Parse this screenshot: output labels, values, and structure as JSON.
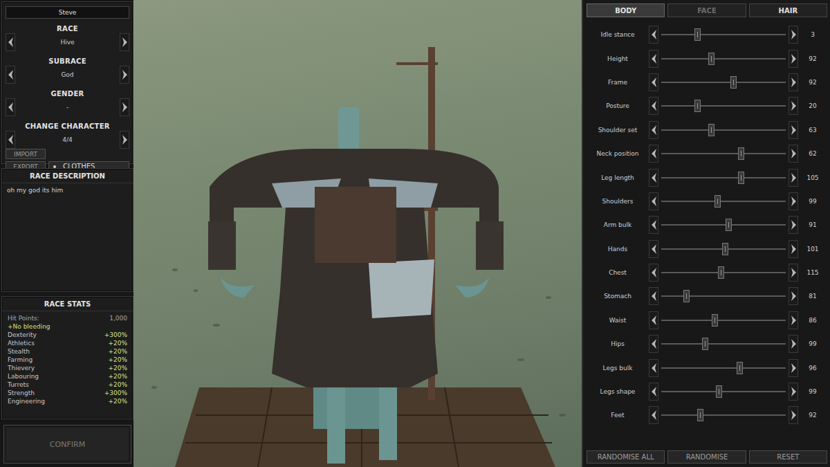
{
  "character": {
    "name": "Steve",
    "fields": [
      {
        "label": "RACE",
        "value": "Hive"
      },
      {
        "label": "SUBRACE",
        "value": "God"
      },
      {
        "label": "GENDER",
        "value": "-"
      },
      {
        "label": "CHANGE CHARACTER",
        "value": "4/4"
      }
    ],
    "buttons": [
      "IMPORT",
      "EXPORT"
    ],
    "clothes": {
      "label": "CLOTHES",
      "checked": true
    }
  },
  "race_description": {
    "title": "RACE DESCRIPTION",
    "text": "oh my god its him"
  },
  "race_stats": {
    "title": "RACE STATS",
    "hit_points": {
      "label": "Hit Points:",
      "value": "1,000"
    },
    "traits": [
      "+No bleeding"
    ],
    "stats": [
      {
        "label": "Dexterity",
        "value": "+300%"
      },
      {
        "label": "Athletics",
        "value": "+20%"
      },
      {
        "label": "Stealth",
        "value": "+20%"
      },
      {
        "label": "Farming",
        "value": "+20%"
      },
      {
        "label": "Thievery",
        "value": "+20%"
      },
      {
        "label": "Labouring",
        "value": "+20%"
      },
      {
        "label": "Turrets",
        "value": "+20%"
      },
      {
        "label": "Strength",
        "value": "+300%"
      },
      {
        "label": "Engineering",
        "value": "+20%"
      }
    ]
  },
  "confirm": {
    "label": "CONFIRM",
    "disabled": true
  },
  "tabs": [
    {
      "label": "BODY",
      "selected": true,
      "disabled": false
    },
    {
      "label": "FACE",
      "selected": false,
      "disabled": true
    },
    {
      "label": "HAIR",
      "selected": false,
      "disabled": false
    }
  ],
  "sliders": [
    {
      "label": "Idle stance",
      "level": 0.29,
      "reading": "3"
    },
    {
      "label": "Height",
      "level": 0.4,
      "reading": "92"
    },
    {
      "label": "Frame",
      "level": 0.58,
      "reading": "92"
    },
    {
      "label": "Posture",
      "level": 0.29,
      "reading": "20"
    },
    {
      "label": "Shoulder set",
      "level": 0.4,
      "reading": "63"
    },
    {
      "label": "Neck position",
      "level": 0.64,
      "reading": "62"
    },
    {
      "label": "Leg length",
      "level": 0.64,
      "reading": "105"
    },
    {
      "label": "Shoulders",
      "level": 0.45,
      "reading": "99"
    },
    {
      "label": "Arm bulk",
      "level": 0.54,
      "reading": "91"
    },
    {
      "label": "Hands",
      "level": 0.51,
      "reading": "101"
    },
    {
      "label": "Chest",
      "level": 0.48,
      "reading": "115"
    },
    {
      "label": "Stomach",
      "level": 0.2,
      "reading": "81"
    },
    {
      "label": "Waist",
      "level": 0.43,
      "reading": "86"
    },
    {
      "label": "Hips",
      "level": 0.35,
      "reading": "99"
    },
    {
      "label": "Legs bulk",
      "level": 0.63,
      "reading": "96"
    },
    {
      "label": "Legs shape",
      "level": 0.46,
      "reading": "99"
    },
    {
      "label": "Feet",
      "level": 0.31,
      "reading": "92"
    }
  ],
  "bottom_buttons": [
    "RANDOMISE ALL",
    "RANDOMISE",
    "RESET"
  ]
}
